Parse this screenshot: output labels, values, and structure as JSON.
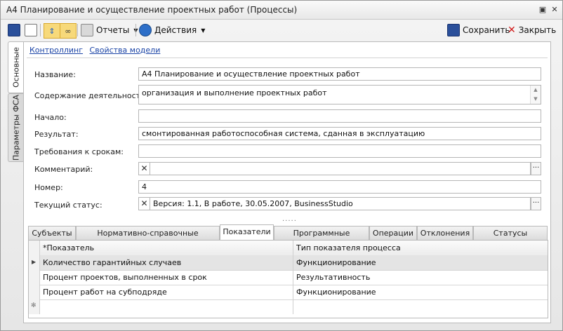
{
  "window": {
    "title": "А4 Планирование и осуществление проектных работ (Процессы)"
  },
  "toolbar": {
    "reports_label": "Отчеты",
    "actions_label": "Действия",
    "save_label": "Сохранить",
    "close_label": "Закрыть"
  },
  "side_tabs": [
    "Основные",
    "Параметры ФСА"
  ],
  "links": [
    "Контроллинг",
    "Свойства модели"
  ],
  "fields": {
    "name_label": "Название:",
    "name_value": "А4 Планирование и осуществление проектных работ",
    "content_label": "Содержание деятельности:",
    "content_value": "организация и выполнение проектных работ",
    "start_label": "Начало:",
    "start_value": "",
    "result_label": "Результат:",
    "result_value": "смонтированная работоспособная система, сданная в эксплуатацию",
    "deadlines_label": "Требования к срокам:",
    "deadlines_value": "",
    "comment_label": "Комментарий:",
    "comment_value": "",
    "number_label": "Номер:",
    "number_value": "4",
    "status_label": "Текущий статус:",
    "status_value": "Версия: 1.1, В работе, 30.05.2007, BusinessStudio"
  },
  "bottom_tabs": [
    "Субъекты",
    "Нормативно-справочные документы",
    "Показатели",
    "Программные продукты",
    "Операции",
    "Отклонения",
    "Статусы процесса"
  ],
  "active_bottom_tab": "Показатели",
  "grid": {
    "columns": [
      "*Показатель",
      "Тип показателя процесса"
    ],
    "rows": [
      {
        "indicator": "Количество гарантийных случаев",
        "type": "Функционирование"
      },
      {
        "indicator": "Процент проектов, выполненных в срок",
        "type": "Результативность"
      },
      {
        "indicator": "Процент работ на субподряде",
        "type": "Функционирование"
      }
    ],
    "new_row_marker": "✻"
  }
}
